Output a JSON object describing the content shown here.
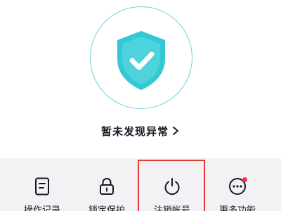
{
  "security_status": {
    "shield_icon": "shield-check-icon",
    "status_text": "暂未发现异常",
    "accent_color": "#33c8d3"
  },
  "tools": [
    {
      "label": "操作记录",
      "icon": "document-icon"
    },
    {
      "label": "锁定保护",
      "icon": "lock-icon"
    },
    {
      "label": "注销帐号",
      "icon": "power-icon",
      "highlighted": true
    },
    {
      "label": "更多功能",
      "icon": "more-icon",
      "has_badge": true
    }
  ],
  "colors": {
    "highlight": "#e53935",
    "badge": "#fe2c55",
    "panel_bg": "#f2f2f4"
  }
}
